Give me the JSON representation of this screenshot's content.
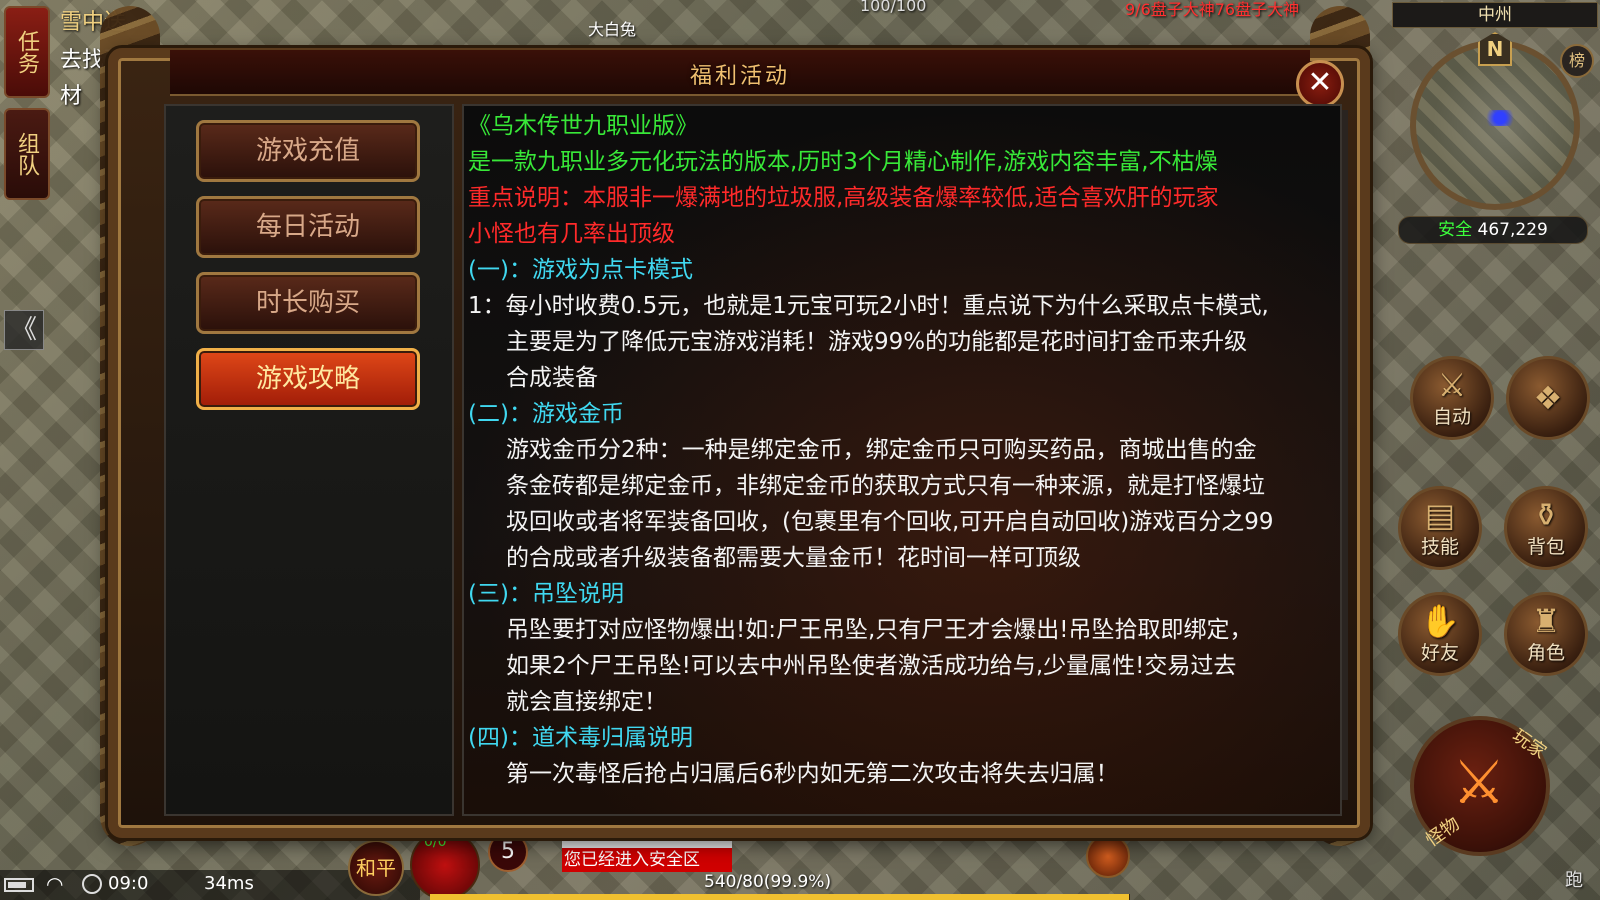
{
  "hud": {
    "task_button": "任务",
    "team_button": "组队",
    "quest_lines": [
      "雪中送",
      "去找落",
      "材"
    ],
    "npc_name": "大白兔",
    "hp_overhead": "100/100",
    "boss_notice": "9/6盘子大神76盘子大神",
    "collapse_glyph": "《"
  },
  "minimap": {
    "map_name": "中州",
    "north_label": "N",
    "rank_label": "榜",
    "safe_label": "安全",
    "coords": "467,229"
  },
  "actions": {
    "auto": "自动",
    "skill": "技能",
    "bag": "背包",
    "friend": "好友",
    "role": "角色",
    "attack_play": "玩家",
    "attack_monster": "怪物",
    "run": "跑"
  },
  "bottom": {
    "time": "09:0",
    "ping": "34ms",
    "peace_mode": "和平",
    "hp_orb": "0/0",
    "level": "5",
    "safe_zone_notice": "您已经进入安全区",
    "exp_text": "540/80(99.9%)",
    "exp_fraction": 0.999
  },
  "dialog": {
    "title": "福利活动",
    "close_glyph": "✕",
    "tabs": [
      "游戏充值",
      "每日活动",
      "时长购买",
      "游戏攻略"
    ],
    "active_tab": 3,
    "lines": [
      {
        "text": "《乌木传世九职业版》",
        "color": "green",
        "indent": false
      },
      {
        "text": "是一款九职业多元化玩法的版本,历时3个月精心制作,游戏内容丰富,不枯燥",
        "color": "green",
        "indent": false
      },
      {
        "text": "重点说明：本服非一爆满地的垃圾服,高级装备爆率较低,适合喜欢肝的玩家",
        "color": "red",
        "indent": false
      },
      {
        "text": "小怪也有几率出顶级",
        "color": "red",
        "indent": false
      },
      {
        "text": "(一)：游戏为点卡模式",
        "color": "cyan",
        "indent": false
      },
      {
        "text": "1：每小时收费0.5元，也就是1元宝可玩2小时！重点说下为什么采取点卡模式,",
        "color": "white",
        "indent": false
      },
      {
        "text": "主要是为了降低元宝游戏消耗！游戏99%的功能都是花时间打金币来升级",
        "color": "white",
        "indent": true
      },
      {
        "text": "合成装备",
        "color": "white",
        "indent": true
      },
      {
        "text": "(二)：游戏金币",
        "color": "cyan",
        "indent": false
      },
      {
        "text": "游戏金币分2种：一种是绑定金币，绑定金币只可购买药品，商城出售的金",
        "color": "white",
        "indent": true
      },
      {
        "text": "条金砖都是绑定金币，非绑定金币的获取方式只有一种来源，就是打怪爆垃",
        "color": "white",
        "indent": true
      },
      {
        "text": "圾回收或者将军装备回收，(包裹里有个回收,可开启自动回收)游戏百分之99",
        "color": "white",
        "indent": true
      },
      {
        "text": "的合成或者升级装备都需要大量金币！花时间一样可顶级",
        "color": "white",
        "indent": true
      },
      {
        "text": "(三)：吊坠说明",
        "color": "cyan",
        "indent": false
      },
      {
        "text": "吊坠要打对应怪物爆出!如:尸王吊坠,只有尸王才会爆出!吊坠拾取即绑定，",
        "color": "white",
        "indent": true
      },
      {
        "text": "如果2个尸王吊坠!可以去中州吊坠使者激活成功给与,少量属性!交易过去",
        "color": "white",
        "indent": true
      },
      {
        "text": "就会直接绑定！",
        "color": "white",
        "indent": true
      },
      {
        "text": "(四)：道术毒归属说明",
        "color": "cyan",
        "indent": false
      },
      {
        "text": "第一次毒怪后抢占归属后6秒内如无第二次攻击将失去归属！",
        "color": "white",
        "indent": true
      }
    ]
  }
}
